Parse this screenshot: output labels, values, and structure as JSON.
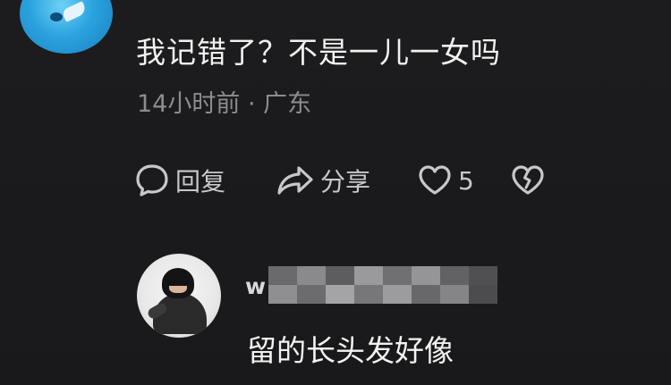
{
  "comment": {
    "text": "我记错了？不是一儿一女吗",
    "meta": "14小时前 · 广东"
  },
  "actions": {
    "reply_label": "回复",
    "share_label": "分享",
    "like_count": "5"
  },
  "icons": {
    "reply": "speech-bubble-icon",
    "share": "share-arrow-icon",
    "like": "heart-outline-icon",
    "dislike": "broken-heart-icon"
  },
  "reply": {
    "username": "w",
    "text": "留的长头发好像"
  },
  "colors": {
    "background": "#1c1c1e",
    "primary_text": "#f2f2f2",
    "secondary_text": "#8c8c90",
    "icon": "#c8c8cc"
  }
}
